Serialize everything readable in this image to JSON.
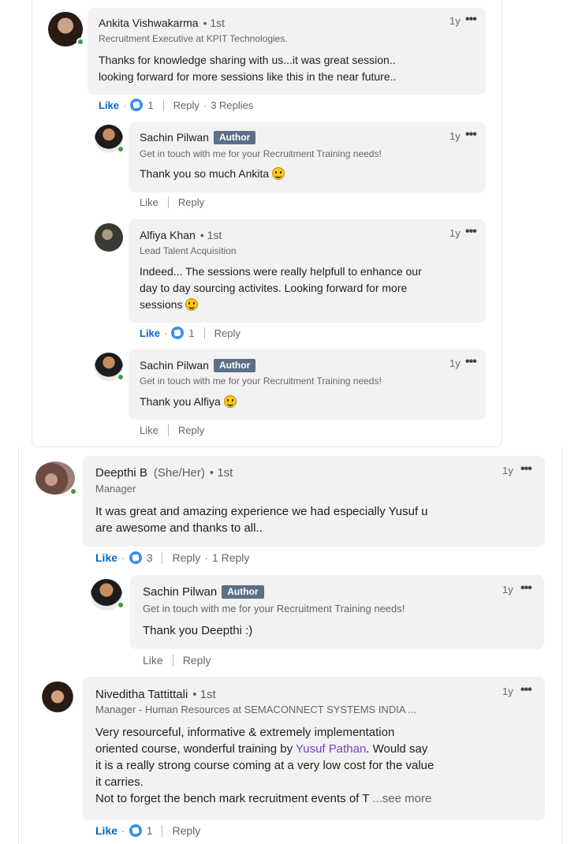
{
  "colors": {
    "like": "#0a66c2",
    "badge": "#5c6f86",
    "bubble": "#f2f2f2",
    "online": "#3a9b3a",
    "mention": "#7b3fc4"
  },
  "comments": [
    {
      "name": "Ankita Vishwakarma",
      "degree": "• 1st",
      "headline": "Recruitment Executive at KPIT Technologies.",
      "time": "1y",
      "body": [
        "Thanks for knowledge sharing with us...it was great session..",
        "looking forward for more sessions like this in the near future.."
      ],
      "like": "Like",
      "reaction_count": "1",
      "reply": "Reply",
      "replies": "3 Replies"
    },
    {
      "name": "Sachin Pilwan",
      "badge": "Author",
      "headline": "Get in touch with me for your Recruitment Training needs!",
      "time": "1y",
      "body": "Thank you so much Ankita",
      "emoji": "smiling-face-icon",
      "like": "Like",
      "reply": "Reply"
    },
    {
      "name": "Alfiya Khan",
      "degree": "• 1st",
      "headline": "Lead Talent Acquisition",
      "time": "1y",
      "body": [
        "Indeed... The sessions were really helpfull to enhance our",
        "day to day sourcing activites. Looking forward for more",
        "sessions"
      ],
      "emoji": "smiling-face-icon",
      "like": "Like",
      "reaction_count": "1",
      "reply": "Reply"
    },
    {
      "name": "Sachin Pilwan",
      "badge": "Author",
      "headline": "Get in touch with me for your Recruitment Training needs!",
      "time": "1y",
      "body": "Thank you Alfiya",
      "emoji": "smiling-face-icon",
      "like": "Like",
      "reply": "Reply"
    },
    {
      "name": "Deepthi B",
      "pronouns": "(She/Her)",
      "degree": "• 1st",
      "headline": "Manager",
      "time": "1y",
      "body": [
        "It was great and amazing experience we had especially Yusuf u",
        "are awesome and thanks to all.."
      ],
      "like": "Like",
      "reaction_count": "3",
      "reply": "Reply",
      "replies": "1 Reply"
    },
    {
      "name": "Sachin Pilwan",
      "badge": "Author",
      "headline": "Get in touch with me for your Recruitment Training needs!",
      "time": "1y",
      "body": "Thank you Deepthi :)",
      "like": "Like",
      "reply": "Reply"
    },
    {
      "name": "Niveditha Tattittali",
      "degree": "• 1st",
      "headline": "Manager - Human Resources at SEMACONNECT SYSTEMS INDIA ...",
      "time": "1y",
      "body_pre": "Very resourceful, informative & extremely implementation",
      "body_line2_pre": "oriented course, wonderful training by ",
      "mention": "Yusuf Pathan",
      "body_line2_post": ". Would say",
      "body_line3": "it is a really strong course coming at a very low cost for the value",
      "body_line4": "it carries.",
      "body_line5": "Not to forget the bench mark recruitment events of T",
      "see_more": "...see more",
      "like": "Like",
      "reaction_count": "1",
      "reply": "Reply"
    }
  ]
}
